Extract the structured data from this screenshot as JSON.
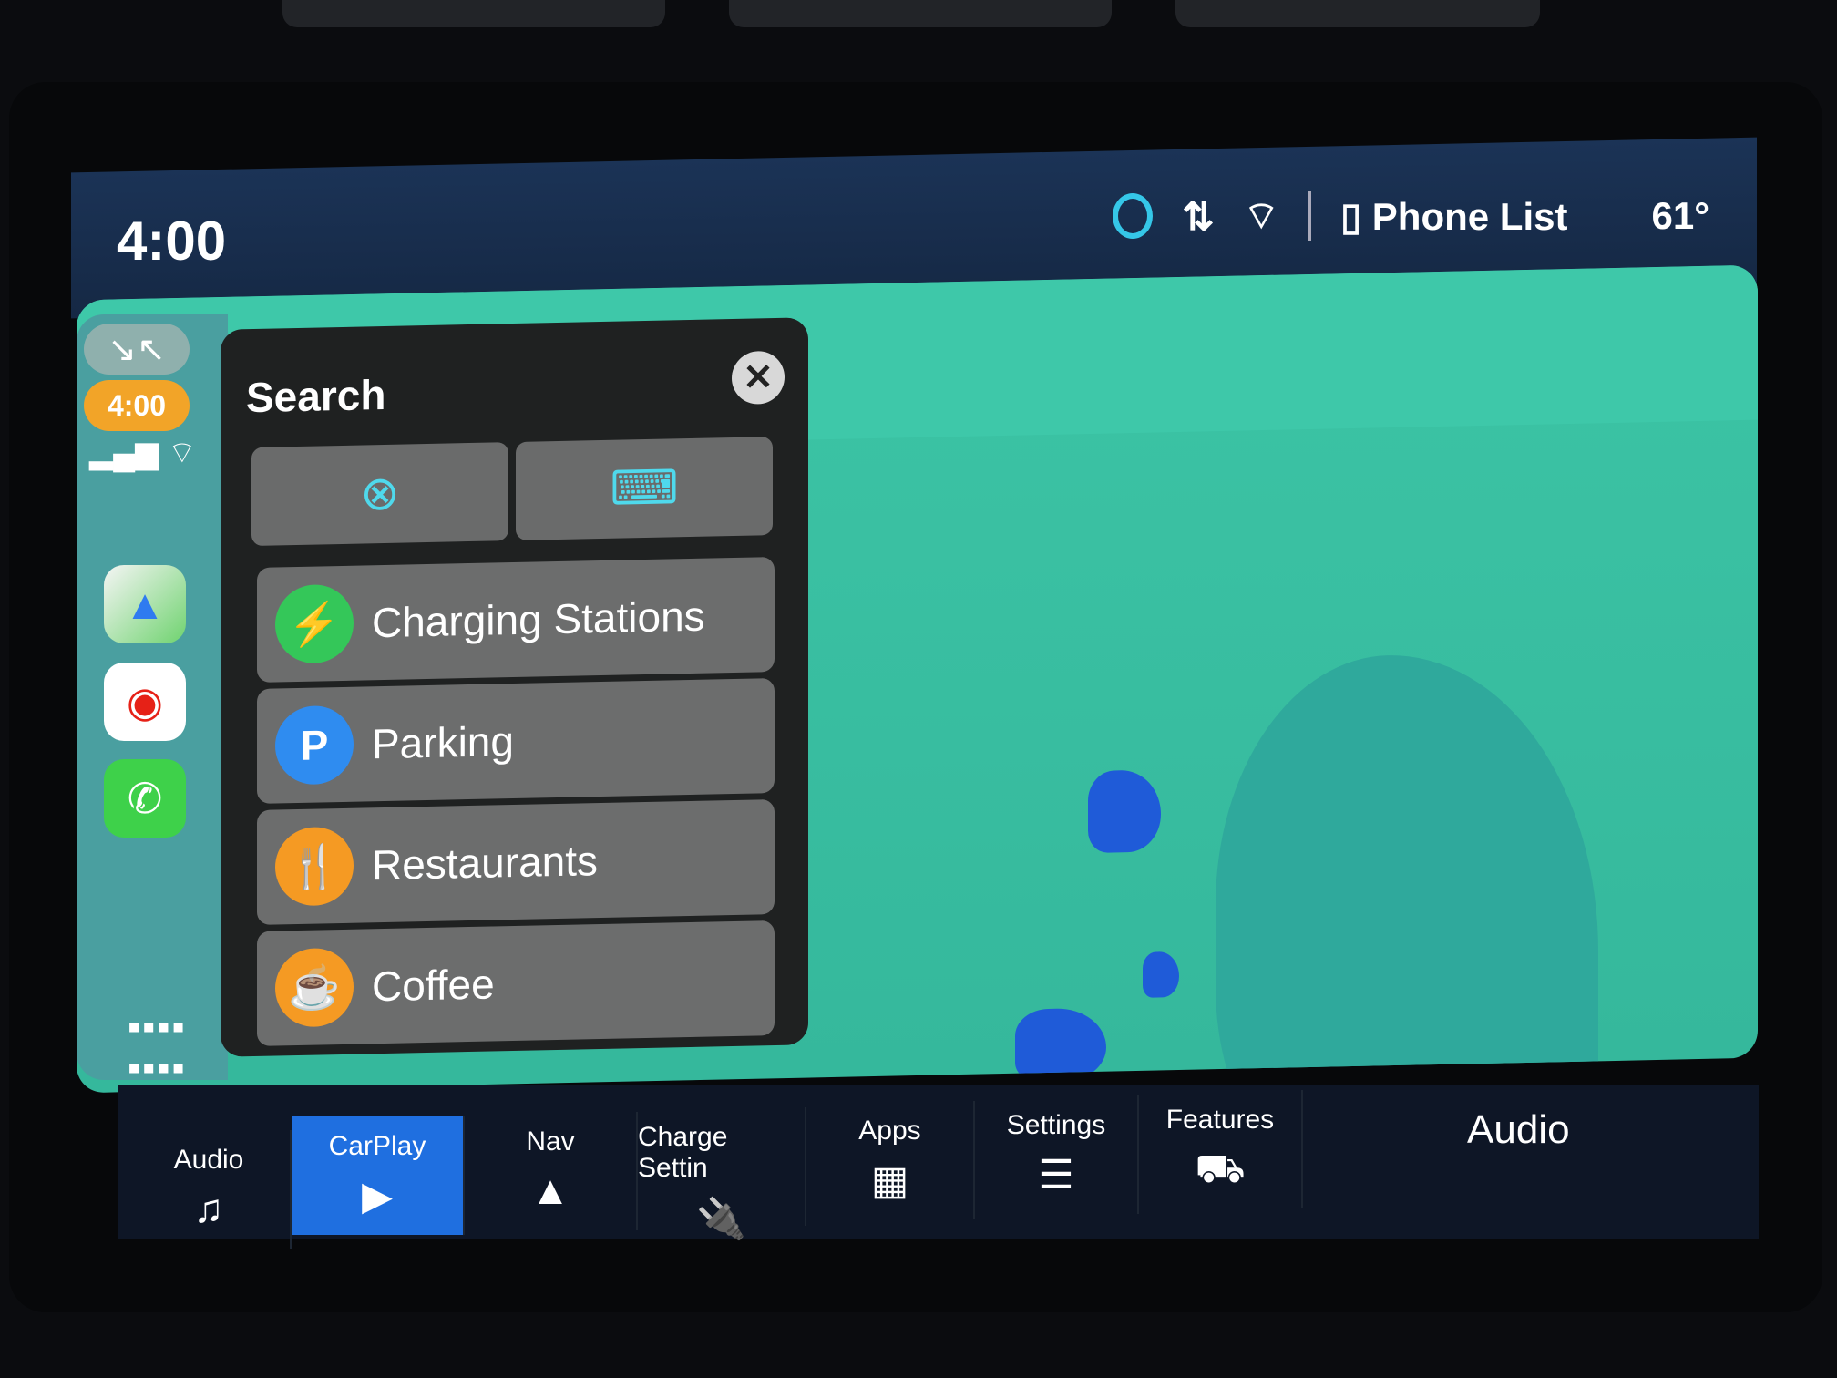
{
  "status_bar": {
    "time": "4:00",
    "phone_list": "Phone List",
    "temperature": "61°",
    "icons": [
      "alexa-icon",
      "data-arrows-icon",
      "wifi-icon",
      "phone-icon"
    ]
  },
  "carplay_sidebar": {
    "time": "4:00",
    "icons": [
      "collapse-icon",
      "signal-icon",
      "wifi-icon",
      "maps-app-icon",
      "youtube-music-app-icon",
      "phone-app-icon",
      "app-grid-icon"
    ]
  },
  "search_panel": {
    "title": "Search",
    "close_icon": "✕",
    "buttons": [
      "siri-icon",
      "keyboard-icon"
    ],
    "items": [
      {
        "label": "Charging Stations",
        "icon": "⚡",
        "color": "#34c759"
      },
      {
        "label": "Parking",
        "icon": "P",
        "color": "#2f8cf0"
      },
      {
        "label": "Restaurants",
        "icon": "🍴",
        "color": "#f59a23"
      },
      {
        "label": "Coffee",
        "icon": "☕",
        "color": "#f59a23"
      }
    ]
  },
  "bottom_nav": {
    "tabs": [
      {
        "label": "Audio",
        "icon": "♫"
      },
      {
        "label": "CarPlay",
        "icon": "▶",
        "active": true
      },
      {
        "label": "Nav",
        "icon": "▲"
      },
      {
        "label": "Charge Settin",
        "icon": "🔌"
      },
      {
        "label": "Apps",
        "icon": "▦"
      },
      {
        "label": "Settings",
        "icon": "☰"
      },
      {
        "label": "Features",
        "icon": "⛟"
      }
    ],
    "right_label": "Audio"
  },
  "colors": {
    "map": "#3cc4a5",
    "active_tab": "#1f6fe0",
    "accent": "#4fd9ec"
  }
}
